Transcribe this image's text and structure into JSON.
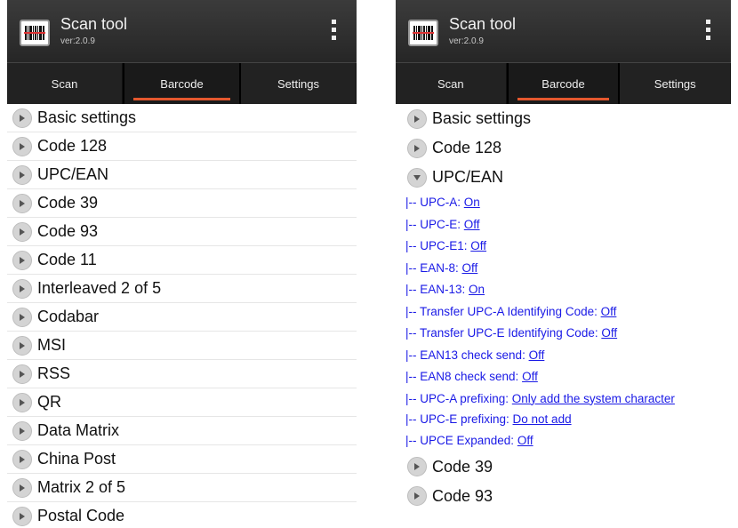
{
  "app": {
    "name": "Scan tool",
    "version": "ver:2.0.9"
  },
  "tabs": [
    "Scan",
    "Barcode",
    "Settings"
  ],
  "left_list": [
    "Basic settings",
    "Code 128",
    "UPC/EAN",
    "Code 39",
    "Code 93",
    "Code 11",
    "Interleaved 2 of 5",
    "Codabar",
    "MSI",
    "RSS",
    "QR",
    "Data Matrix",
    "China Post",
    "Matrix 2 of 5",
    "Postal Code"
  ],
  "right_list_top": [
    "Basic settings",
    "Code 128",
    "UPC/EAN"
  ],
  "upc_settings": [
    {
      "label": "|-- UPC-A: ",
      "value": "On"
    },
    {
      "label": "|-- UPC-E: ",
      "value": "Off"
    },
    {
      "label": "|-- UPC-E1: ",
      "value": "Off"
    },
    {
      "label": "|-- EAN-8: ",
      "value": "Off"
    },
    {
      "label": "|-- EAN-13: ",
      "value": "On"
    },
    {
      "label": "|-- Transfer UPC-A Identifying Code: ",
      "value": "Off"
    },
    {
      "label": "|-- Transfer UPC-E Identifying Code: ",
      "value": "Off"
    },
    {
      "label": "|-- EAN13 check send: ",
      "value": "Off"
    },
    {
      "label": "|-- EAN8 check send: ",
      "value": "Off"
    },
    {
      "label": "|-- UPC-A prefixing: ",
      "value": "Only add the system character"
    },
    {
      "label": "|-- UPC-E prefixing: ",
      "value": "Do not add"
    },
    {
      "label": "|-- UPCE Expanded: ",
      "value": "Off"
    }
  ],
  "right_list_bottom": [
    "Code 39",
    "Code 93"
  ]
}
